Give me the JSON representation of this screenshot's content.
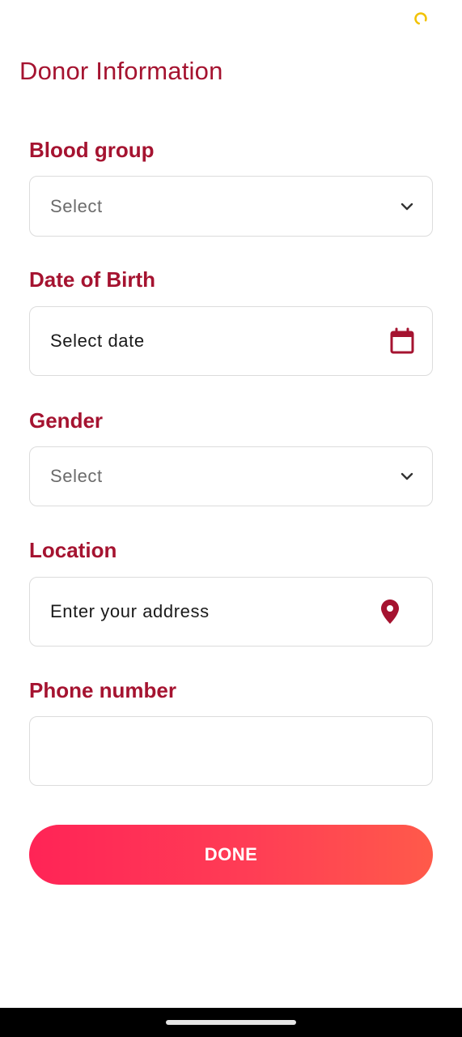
{
  "header": {
    "title": "Donor Information"
  },
  "form": {
    "blood_group": {
      "label": "Blood group",
      "placeholder": "Select",
      "icon": "chevron-down-icon"
    },
    "date_of_birth": {
      "label": "Date of Birth",
      "value": "Select date",
      "icon": "calendar-icon"
    },
    "gender": {
      "label": "Gender",
      "placeholder": "Select",
      "icon": "chevron-down-icon"
    },
    "location": {
      "label": "Location",
      "value": "Enter your address",
      "icon": "location-pin-icon"
    },
    "phone_number": {
      "label": "Phone number",
      "value": ""
    }
  },
  "actions": {
    "done_label": "DONE"
  },
  "colors": {
    "accent": "#a51330",
    "button_gradient_start": "#ff2456",
    "button_gradient_end": "#ff5a4a",
    "spinner": "#f2c200",
    "border": "#dcdcdc"
  }
}
